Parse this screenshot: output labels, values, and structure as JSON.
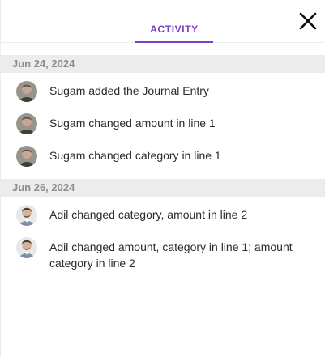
{
  "header": {
    "tab_label": "ACTIVITY",
    "accent_color": "#7a3fc4",
    "close_icon": "close-icon"
  },
  "groups": [
    {
      "date": "Jun 24, 2024",
      "entries": [
        {
          "avatar": "sugam-avatar",
          "text": "Sugam added the Journal Entry"
        },
        {
          "avatar": "sugam-avatar",
          "text": "Sugam changed amount in line 1"
        },
        {
          "avatar": "sugam-avatar",
          "text": "Sugam changed category in line 1"
        }
      ]
    },
    {
      "date": "Jun 26, 2024",
      "entries": [
        {
          "avatar": "adil-avatar",
          "text": "Adil changed category, amount in line 2"
        },
        {
          "avatar": "adil-avatar",
          "text": "Adil changed amount, category in line 1; amount category in line 2"
        }
      ]
    }
  ]
}
